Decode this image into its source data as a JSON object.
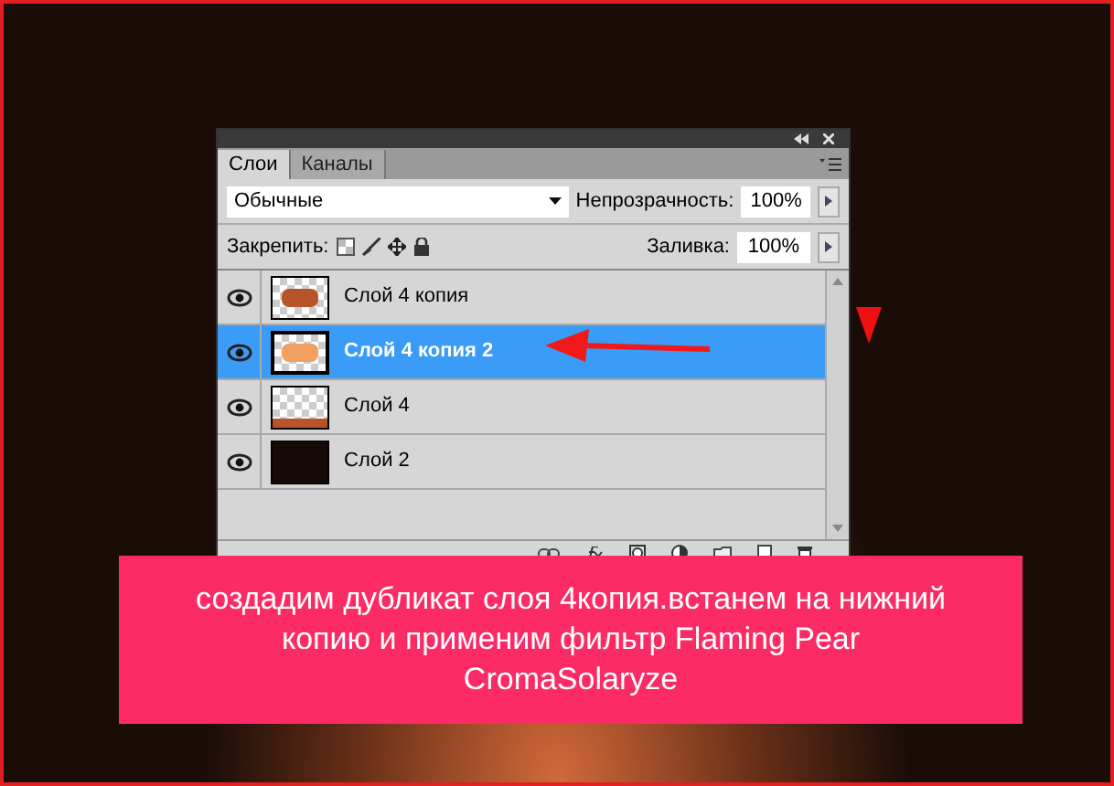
{
  "panel": {
    "tabs": [
      {
        "label": "Слои",
        "selected": true
      },
      {
        "label": "Каналы",
        "selected": false
      }
    ],
    "blend_mode": "Обычные",
    "opacity_label": "Непрозрачность:",
    "opacity_value": "100%",
    "lock_label": "Закрепить:",
    "fill_label": "Заливка:",
    "fill_value": "100%",
    "layers": [
      {
        "name": "Слой 4 копия",
        "selected": false,
        "visible": true,
        "kind": "art"
      },
      {
        "name": "Слой 4 копия 2",
        "selected": true,
        "visible": true,
        "kind": "art"
      },
      {
        "name": "Слой 4",
        "selected": false,
        "visible": true,
        "kind": "bottom"
      },
      {
        "name": "Слой 2",
        "selected": false,
        "visible": true,
        "kind": "dark"
      }
    ]
  },
  "caption": "создадим дубликат слоя 4копия.встанем на нижний копию и применим фильтр Flaming Pear CromaSolaryze"
}
